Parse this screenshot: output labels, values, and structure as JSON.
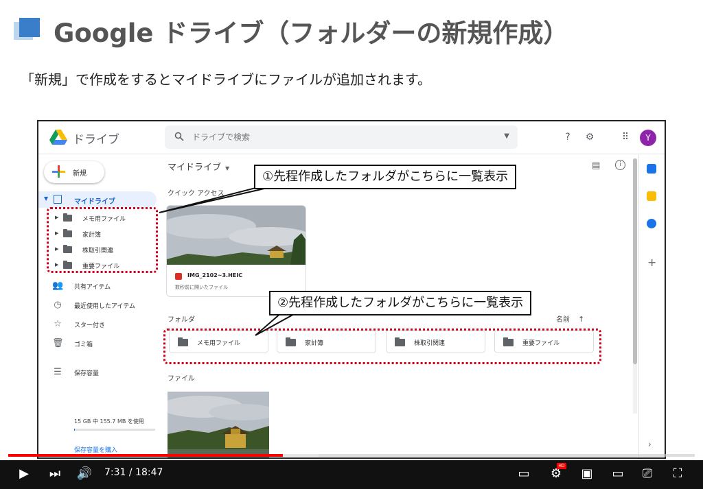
{
  "slide": {
    "title": "Google ドライブ（フォルダーの新規作成）",
    "subtitle": "「新規」で作成をするとマイドライブにファイルが追加されます。"
  },
  "drive": {
    "app_name": "ドライブ",
    "search": {
      "placeholder": "ドライブで検索",
      "value": ""
    },
    "avatar_letter": "Y",
    "new_button": "新規",
    "my_drive": "マイドライブ",
    "tree": [
      "メモ用ファイル",
      "家計簿",
      "株取引関連",
      "重要ファイル"
    ],
    "nav": [
      {
        "icon": "shared-icon",
        "label": "共有アイテム"
      },
      {
        "icon": "recent-icon",
        "label": "最近使用したアイテム"
      },
      {
        "icon": "star-icon",
        "label": "スター付き"
      },
      {
        "icon": "trash-icon",
        "label": "ゴミ箱"
      },
      {
        "icon": "storage-icon",
        "label": "保存容量"
      }
    ],
    "storage_text": "15 GB 中 155.7 MB を使用",
    "storage_used_fraction": 0.01,
    "storage_buy": "保存容量を購入",
    "breadcrumb": "マイドライブ",
    "quick_access_label": "クイック アクセス",
    "quick_access_file": {
      "name": "IMG_2102~3.HEIC",
      "sub": "数秒前に開いたファイル"
    },
    "folders_label": "フォルダ",
    "sort_label": "名前",
    "folders": [
      "メモ用ファイル",
      "家計簿",
      "株取引関連",
      "重要ファイル"
    ],
    "files_label": "ファイル"
  },
  "callouts": {
    "one": "①先程作成したフォルダがこちらに一覧表示",
    "two": "②先程作成したフォルダがこちらに一覧表示"
  },
  "player": {
    "time": "7:31 / 18:47",
    "progress_fraction": 0.4,
    "hd": "HD"
  },
  "colors": {
    "title_gray": "#555555",
    "drive_blue": "#1967d2",
    "highlight_red": "#d0021b",
    "progress_red": "#ff0000"
  }
}
